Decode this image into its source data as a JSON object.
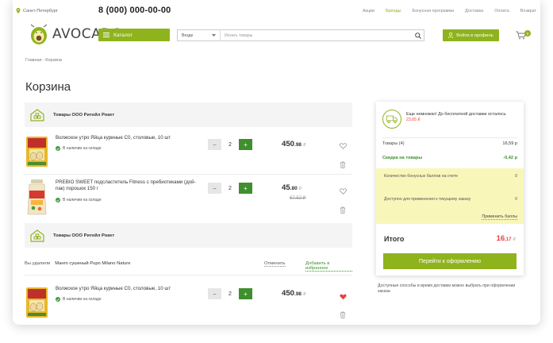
{
  "header": {
    "city": "Санкт-Петербург",
    "phone": "8 (000) 000-00-00",
    "links": [
      "Акции",
      "Бренды",
      "Бонусная программа",
      "Доставка",
      "Оплата",
      "Возврат"
    ],
    "active_link_index": 1,
    "logo_text": "AVOCADO",
    "catalog_label": "Каталог",
    "search_scope": "Везде",
    "search_placeholder": "Искать товары",
    "login_label": "Войти в профиль",
    "cart_count": "0"
  },
  "breadcrumb": "Главная - Корзина",
  "page_title": "Корзина",
  "sellers": [
    {
      "name": "Товары ООО Ритейл Рокет"
    },
    {
      "name": "Товары ООО Ритейл Рокет"
    }
  ],
  "items": [
    {
      "name": "Волжское утро Яйца куриные С0, столовые, 10 шт",
      "availability": "В наличии на складе",
      "qty": "2",
      "price_main": "450",
      "price_kop": ".98",
      "currency": "₽",
      "old_price": "",
      "favorite": false
    },
    {
      "name": "PREBIO SWEET подсластитель Fitness с пребиотиками (дой-пак) порошок 150 г",
      "availability": "В наличии на складе",
      "qty": "2",
      "price_main": "45",
      "price_kop": ".80",
      "currency": "₽",
      "old_price": "67.52 ₽",
      "favorite": false
    },
    {
      "name": "Волжское утро Яйца куриные С0, столовые, 10 шт",
      "availability": "В наличии на складе",
      "qty": "2",
      "price_main": "450",
      "price_kop": ".98",
      "currency": "₽",
      "old_price": "",
      "favorite": true
    }
  ],
  "removed": {
    "prefix": "Вы удалили",
    "product": "Манго сушеный Pupo Milano Nature",
    "undo": "Отменить",
    "to_favorites": "Добавить в избранное"
  },
  "summary": {
    "promo_text": "Еще немножко! До бесплатной доставки осталось",
    "promo_amount": "23,65 ₽",
    "goods_label": "Товары (4)",
    "goods_value": "16,59 р",
    "discount_label": "Скидка на товары",
    "discount_value": "-0,42 р",
    "bonus_label": "Количество бонусных баллов на счете",
    "bonus_value": "0",
    "available_label": "Доступно для применения к текущему заказу",
    "available_value": "0",
    "apply_label": "Применить баллы",
    "total_label": "Итого",
    "total_main": "16",
    "total_kop": ",17",
    "total_currency": "₽",
    "checkout_label": "Перейти к оформлению"
  },
  "delivery_note": "Доступные способы и время доставки можно выбрать при оформлении заказа",
  "colors": {
    "accent": "#8fb31d",
    "dark_green": "#3f8f2e",
    "red": "#e8413e",
    "highlight": "#f9f6ba"
  }
}
